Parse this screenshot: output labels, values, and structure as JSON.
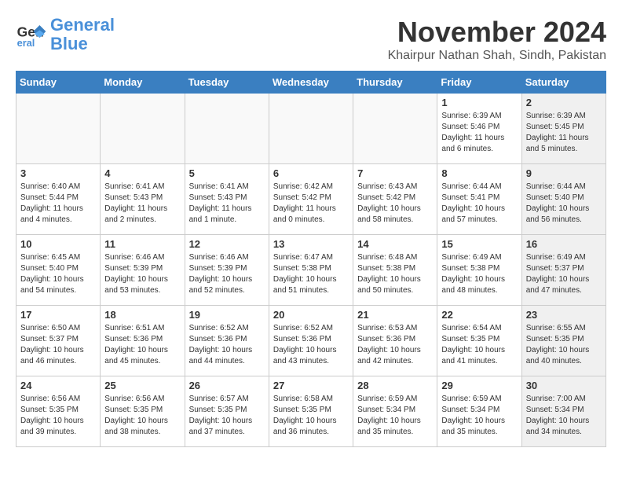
{
  "header": {
    "logo_line1": "General",
    "logo_line2": "Blue",
    "month": "November 2024",
    "location": "Khairpur Nathan Shah, Sindh, Pakistan"
  },
  "weekdays": [
    "Sunday",
    "Monday",
    "Tuesday",
    "Wednesday",
    "Thursday",
    "Friday",
    "Saturday"
  ],
  "weeks": [
    [
      {
        "day": "",
        "info": "",
        "shaded": false,
        "empty": true
      },
      {
        "day": "",
        "info": "",
        "shaded": false,
        "empty": true
      },
      {
        "day": "",
        "info": "",
        "shaded": false,
        "empty": true
      },
      {
        "day": "",
        "info": "",
        "shaded": false,
        "empty": true
      },
      {
        "day": "",
        "info": "",
        "shaded": false,
        "empty": true
      },
      {
        "day": "1",
        "info": "Sunrise: 6:39 AM\nSunset: 5:46 PM\nDaylight: 11 hours\nand 6 minutes.",
        "shaded": false,
        "empty": false
      },
      {
        "day": "2",
        "info": "Sunrise: 6:39 AM\nSunset: 5:45 PM\nDaylight: 11 hours\nand 5 minutes.",
        "shaded": true,
        "empty": false
      }
    ],
    [
      {
        "day": "3",
        "info": "Sunrise: 6:40 AM\nSunset: 5:44 PM\nDaylight: 11 hours\nand 4 minutes.",
        "shaded": false,
        "empty": false
      },
      {
        "day": "4",
        "info": "Sunrise: 6:41 AM\nSunset: 5:43 PM\nDaylight: 11 hours\nand 2 minutes.",
        "shaded": false,
        "empty": false
      },
      {
        "day": "5",
        "info": "Sunrise: 6:41 AM\nSunset: 5:43 PM\nDaylight: 11 hours\nand 1 minute.",
        "shaded": false,
        "empty": false
      },
      {
        "day": "6",
        "info": "Sunrise: 6:42 AM\nSunset: 5:42 PM\nDaylight: 11 hours\nand 0 minutes.",
        "shaded": false,
        "empty": false
      },
      {
        "day": "7",
        "info": "Sunrise: 6:43 AM\nSunset: 5:42 PM\nDaylight: 10 hours\nand 58 minutes.",
        "shaded": false,
        "empty": false
      },
      {
        "day": "8",
        "info": "Sunrise: 6:44 AM\nSunset: 5:41 PM\nDaylight: 10 hours\nand 57 minutes.",
        "shaded": false,
        "empty": false
      },
      {
        "day": "9",
        "info": "Sunrise: 6:44 AM\nSunset: 5:40 PM\nDaylight: 10 hours\nand 56 minutes.",
        "shaded": true,
        "empty": false
      }
    ],
    [
      {
        "day": "10",
        "info": "Sunrise: 6:45 AM\nSunset: 5:40 PM\nDaylight: 10 hours\nand 54 minutes.",
        "shaded": false,
        "empty": false
      },
      {
        "day": "11",
        "info": "Sunrise: 6:46 AM\nSunset: 5:39 PM\nDaylight: 10 hours\nand 53 minutes.",
        "shaded": false,
        "empty": false
      },
      {
        "day": "12",
        "info": "Sunrise: 6:46 AM\nSunset: 5:39 PM\nDaylight: 10 hours\nand 52 minutes.",
        "shaded": false,
        "empty": false
      },
      {
        "day": "13",
        "info": "Sunrise: 6:47 AM\nSunset: 5:38 PM\nDaylight: 10 hours\nand 51 minutes.",
        "shaded": false,
        "empty": false
      },
      {
        "day": "14",
        "info": "Sunrise: 6:48 AM\nSunset: 5:38 PM\nDaylight: 10 hours\nand 50 minutes.",
        "shaded": false,
        "empty": false
      },
      {
        "day": "15",
        "info": "Sunrise: 6:49 AM\nSunset: 5:38 PM\nDaylight: 10 hours\nand 48 minutes.",
        "shaded": false,
        "empty": false
      },
      {
        "day": "16",
        "info": "Sunrise: 6:49 AM\nSunset: 5:37 PM\nDaylight: 10 hours\nand 47 minutes.",
        "shaded": true,
        "empty": false
      }
    ],
    [
      {
        "day": "17",
        "info": "Sunrise: 6:50 AM\nSunset: 5:37 PM\nDaylight: 10 hours\nand 46 minutes.",
        "shaded": false,
        "empty": false
      },
      {
        "day": "18",
        "info": "Sunrise: 6:51 AM\nSunset: 5:36 PM\nDaylight: 10 hours\nand 45 minutes.",
        "shaded": false,
        "empty": false
      },
      {
        "day": "19",
        "info": "Sunrise: 6:52 AM\nSunset: 5:36 PM\nDaylight: 10 hours\nand 44 minutes.",
        "shaded": false,
        "empty": false
      },
      {
        "day": "20",
        "info": "Sunrise: 6:52 AM\nSunset: 5:36 PM\nDaylight: 10 hours\nand 43 minutes.",
        "shaded": false,
        "empty": false
      },
      {
        "day": "21",
        "info": "Sunrise: 6:53 AM\nSunset: 5:36 PM\nDaylight: 10 hours\nand 42 minutes.",
        "shaded": false,
        "empty": false
      },
      {
        "day": "22",
        "info": "Sunrise: 6:54 AM\nSunset: 5:35 PM\nDaylight: 10 hours\nand 41 minutes.",
        "shaded": false,
        "empty": false
      },
      {
        "day": "23",
        "info": "Sunrise: 6:55 AM\nSunset: 5:35 PM\nDaylight: 10 hours\nand 40 minutes.",
        "shaded": true,
        "empty": false
      }
    ],
    [
      {
        "day": "24",
        "info": "Sunrise: 6:56 AM\nSunset: 5:35 PM\nDaylight: 10 hours\nand 39 minutes.",
        "shaded": false,
        "empty": false
      },
      {
        "day": "25",
        "info": "Sunrise: 6:56 AM\nSunset: 5:35 PM\nDaylight: 10 hours\nand 38 minutes.",
        "shaded": false,
        "empty": false
      },
      {
        "day": "26",
        "info": "Sunrise: 6:57 AM\nSunset: 5:35 PM\nDaylight: 10 hours\nand 37 minutes.",
        "shaded": false,
        "empty": false
      },
      {
        "day": "27",
        "info": "Sunrise: 6:58 AM\nSunset: 5:35 PM\nDaylight: 10 hours\nand 36 minutes.",
        "shaded": false,
        "empty": false
      },
      {
        "day": "28",
        "info": "Sunrise: 6:59 AM\nSunset: 5:34 PM\nDaylight: 10 hours\nand 35 minutes.",
        "shaded": false,
        "empty": false
      },
      {
        "day": "29",
        "info": "Sunrise: 6:59 AM\nSunset: 5:34 PM\nDaylight: 10 hours\nand 35 minutes.",
        "shaded": false,
        "empty": false
      },
      {
        "day": "30",
        "info": "Sunrise: 7:00 AM\nSunset: 5:34 PM\nDaylight: 10 hours\nand 34 minutes.",
        "shaded": true,
        "empty": false
      }
    ]
  ]
}
